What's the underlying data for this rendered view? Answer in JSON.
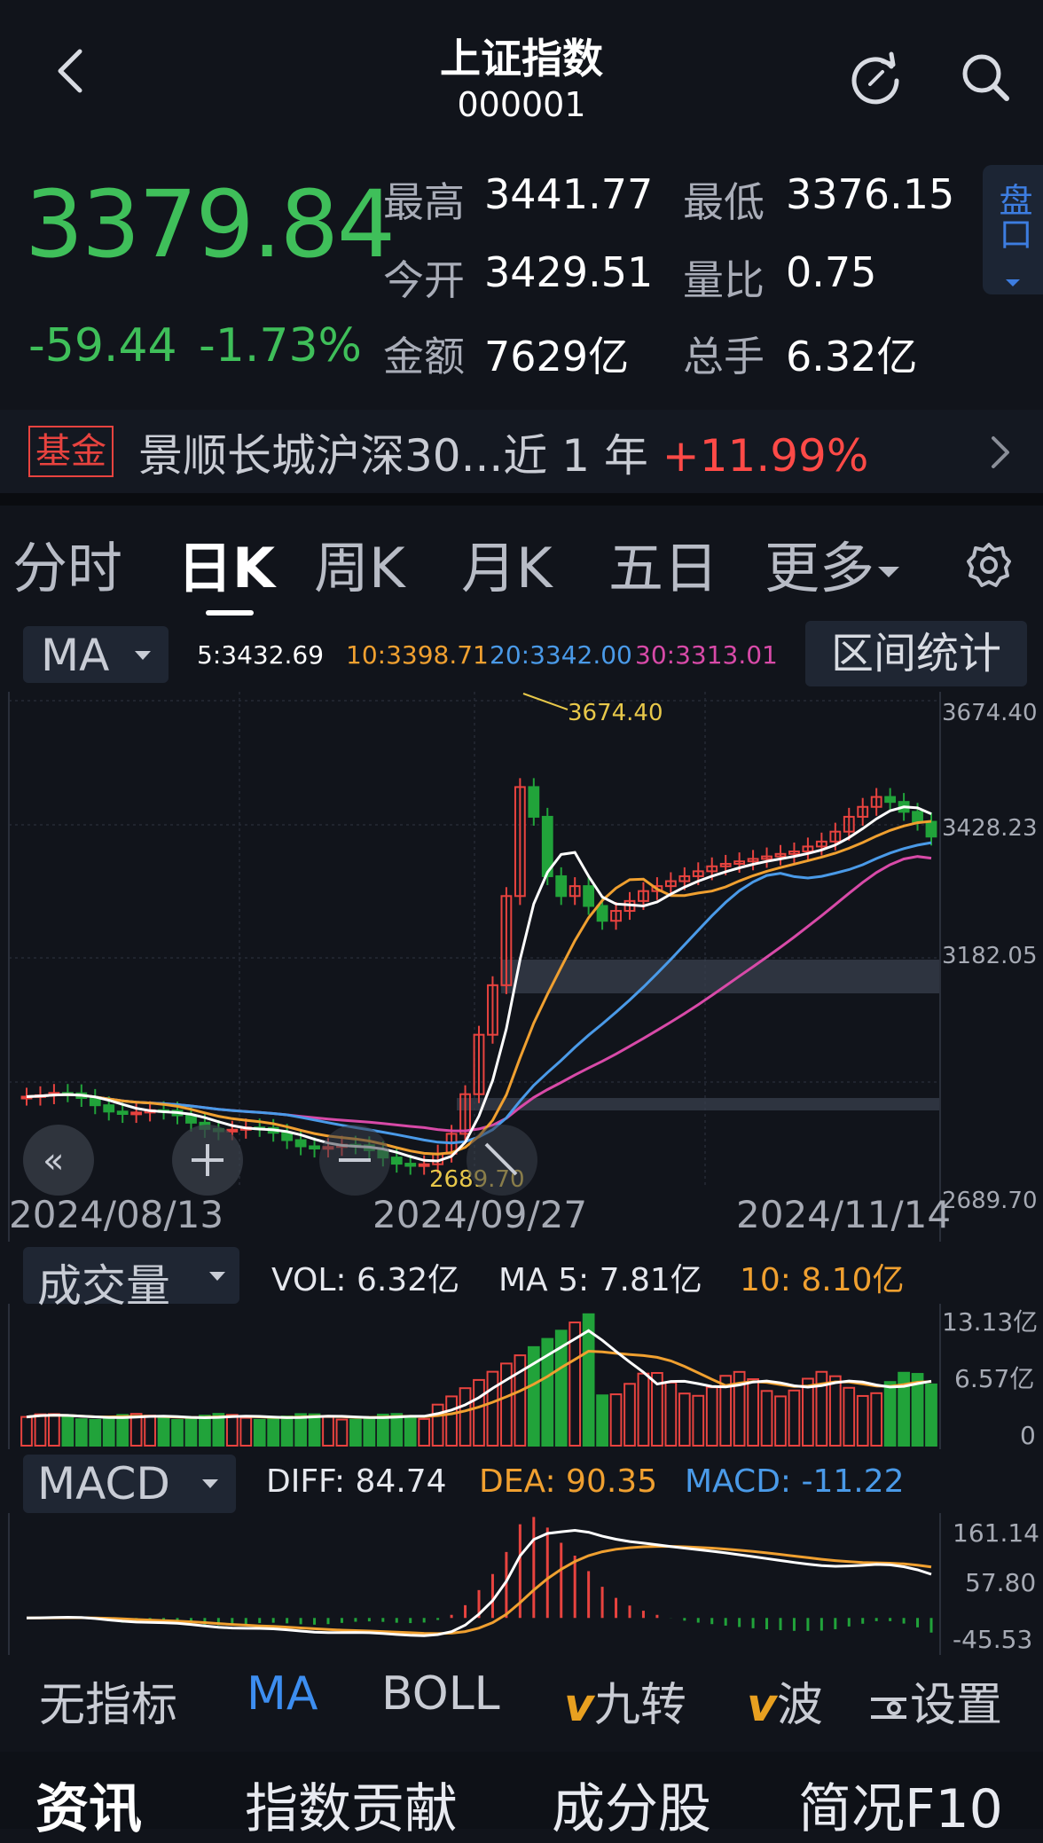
{
  "header": {
    "title": "上证指数",
    "code": "000001"
  },
  "quote": {
    "price": "3379.84",
    "change": "-59.44",
    "change_pct": "-1.73%",
    "stats": [
      {
        "label": "最高",
        "value": "3441.77"
      },
      {
        "label": "最低",
        "value": "3376.15"
      },
      {
        "label": "今开",
        "value": "3429.51"
      },
      {
        "label": "量比",
        "value": "0.75"
      },
      {
        "label": "金额",
        "value": "7629亿"
      },
      {
        "label": "总手",
        "value": "6.32亿"
      }
    ],
    "pankou_label": "盘口"
  },
  "fund": {
    "tag": "基金",
    "text": "景顺长城沪深30...近 1 年 ",
    "pct": "+11.99%"
  },
  "tabs": [
    {
      "label": "分时"
    },
    {
      "label": "日K"
    },
    {
      "label": "周K"
    },
    {
      "label": "月K"
    },
    {
      "label": "五日"
    },
    {
      "label": "更多"
    }
  ],
  "ma_legend": {
    "selector": "MA",
    "ma5": "5:3432.69",
    "ma10": "10:3398.71",
    "ma20": "20:3342.00",
    "ma30": "30:3313.01",
    "interval_button": "区间统计"
  },
  "price_chart": {
    "y_labels": [
      "3674.40",
      "3428.23",
      "3182.05",
      "2689.70"
    ],
    "x_labels": [
      "2024/08/13",
      "2024/09/27",
      "2024/11/14"
    ],
    "high_marker": "3674.40",
    "low_marker": "2689.70"
  },
  "volume": {
    "selector": "成交量",
    "vol": "VOL: 6.32亿",
    "ma5": "MA 5: 7.81亿",
    "ma10": "10: 8.10亿",
    "y_labels": [
      "13.13亿",
      "6.57亿",
      "0"
    ]
  },
  "macd": {
    "selector": "MACD",
    "diff": "DIFF: 84.74",
    "dea": "DEA: 90.35",
    "macd": "MACD: -11.22",
    "y_labels": [
      "161.14",
      "57.80",
      "-45.53"
    ]
  },
  "indicators": {
    "none": "无指标",
    "ma": "MA",
    "boll": "BOLL",
    "jiuzhuan": "九转",
    "bo": "波",
    "settings": "设置"
  },
  "bottom_nav": [
    {
      "label": "资讯"
    },
    {
      "label": "指数贡献"
    },
    {
      "label": "成分股"
    },
    {
      "label": "简况F10"
    }
  ],
  "colors": {
    "up": "#e8433f",
    "down": "#21a33a",
    "green_text": "#3fbf5a",
    "ma5": "#ffffff",
    "ma10": "#f0a030",
    "ma20": "#4a9ae8",
    "ma30": "#d84aa8"
  }
}
